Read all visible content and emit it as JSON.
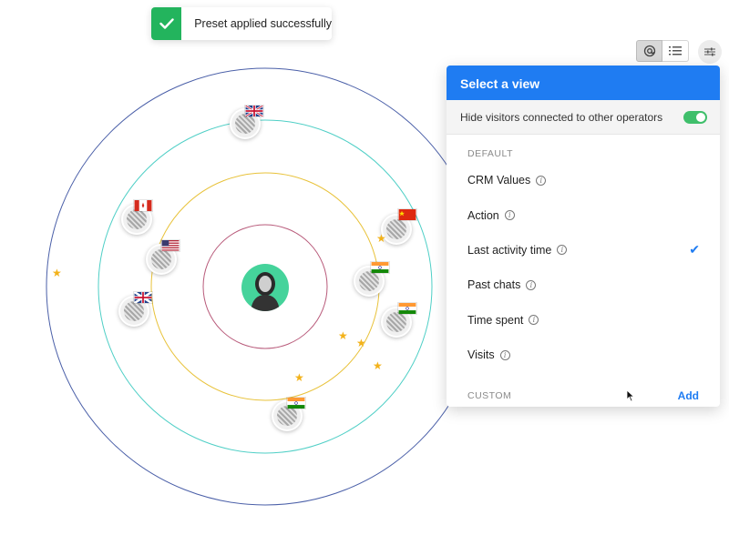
{
  "toast": {
    "text": "Preset applied successfully",
    "icon": "check-icon",
    "color": "#23b45d"
  },
  "toolbar": {
    "buttons": [
      "radar-view-icon",
      "list-view-icon"
    ],
    "filter_icon": "sliders-icon"
  },
  "panel": {
    "title": "Select a view",
    "accent": "#1f7cf2",
    "hide_toggle_label": "Hide visitors connected to other operators",
    "hide_toggle_on": true,
    "default_label": "DEFAULT",
    "options": [
      {
        "label": "CRM Values",
        "selected": false
      },
      {
        "label": "Action",
        "selected": false
      },
      {
        "label": "Last activity time",
        "selected": true
      },
      {
        "label": "Past chats",
        "selected": false
      },
      {
        "label": "Time spent",
        "selected": false
      },
      {
        "label": "Visits",
        "selected": false
      }
    ],
    "custom_label": "CUSTOM",
    "add_label": "Add"
  },
  "visitors": [
    {
      "country": "UK"
    },
    {
      "country": "Canada"
    },
    {
      "country": "USA"
    },
    {
      "country": "UK"
    },
    {
      "country": "China"
    },
    {
      "country": "India"
    },
    {
      "country": "India"
    },
    {
      "country": "India"
    }
  ]
}
